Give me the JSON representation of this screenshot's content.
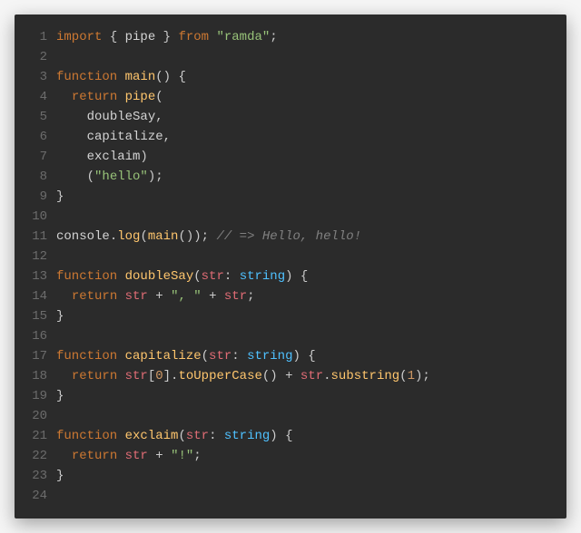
{
  "code": {
    "lines": [
      {
        "n": "1",
        "tokens": [
          {
            "c": "kw",
            "t": "import "
          },
          {
            "c": "punct",
            "t": "{ "
          },
          {
            "c": "ident",
            "t": "pipe"
          },
          {
            "c": "punct",
            "t": " } "
          },
          {
            "c": "kw",
            "t": "from "
          },
          {
            "c": "str",
            "t": "\"ramda\""
          },
          {
            "c": "punct",
            "t": ";"
          }
        ]
      },
      {
        "n": "2",
        "tokens": []
      },
      {
        "n": "3",
        "tokens": [
          {
            "c": "kw",
            "t": "function "
          },
          {
            "c": "fn",
            "t": "main"
          },
          {
            "c": "punct",
            "t": "() {"
          }
        ]
      },
      {
        "n": "4",
        "tokens": [
          {
            "c": "punct",
            "t": "  "
          },
          {
            "c": "kw",
            "t": "return "
          },
          {
            "c": "fn",
            "t": "pipe"
          },
          {
            "c": "punct",
            "t": "("
          }
        ]
      },
      {
        "n": "5",
        "tokens": [
          {
            "c": "punct",
            "t": "    "
          },
          {
            "c": "ident",
            "t": "doubleSay"
          },
          {
            "c": "punct",
            "t": ","
          }
        ]
      },
      {
        "n": "6",
        "tokens": [
          {
            "c": "punct",
            "t": "    "
          },
          {
            "c": "ident",
            "t": "capitalize"
          },
          {
            "c": "punct",
            "t": ","
          }
        ]
      },
      {
        "n": "7",
        "tokens": [
          {
            "c": "punct",
            "t": "    "
          },
          {
            "c": "ident",
            "t": "exclaim"
          },
          {
            "c": "punct",
            "t": ")"
          }
        ]
      },
      {
        "n": "8",
        "tokens": [
          {
            "c": "punct",
            "t": "    ("
          },
          {
            "c": "str",
            "t": "\"hello\""
          },
          {
            "c": "punct",
            "t": ");"
          }
        ]
      },
      {
        "n": "9",
        "tokens": [
          {
            "c": "punct",
            "t": "}"
          }
        ]
      },
      {
        "n": "10",
        "tokens": []
      },
      {
        "n": "11",
        "tokens": [
          {
            "c": "ident",
            "t": "console"
          },
          {
            "c": "punct",
            "t": "."
          },
          {
            "c": "fn",
            "t": "log"
          },
          {
            "c": "punct",
            "t": "("
          },
          {
            "c": "fn",
            "t": "main"
          },
          {
            "c": "punct",
            "t": "()); "
          },
          {
            "c": "comment",
            "t": "// => Hello, hello!"
          }
        ]
      },
      {
        "n": "12",
        "tokens": []
      },
      {
        "n": "13",
        "tokens": [
          {
            "c": "kw",
            "t": "function "
          },
          {
            "c": "fn",
            "t": "doubleSay"
          },
          {
            "c": "punct",
            "t": "("
          },
          {
            "c": "param",
            "t": "str"
          },
          {
            "c": "punct",
            "t": ": "
          },
          {
            "c": "type",
            "t": "string"
          },
          {
            "c": "punct",
            "t": ") {"
          }
        ]
      },
      {
        "n": "14",
        "tokens": [
          {
            "c": "punct",
            "t": "  "
          },
          {
            "c": "kw",
            "t": "return "
          },
          {
            "c": "param",
            "t": "str"
          },
          {
            "c": "punct",
            "t": " + "
          },
          {
            "c": "str",
            "t": "\", \""
          },
          {
            "c": "punct",
            "t": " + "
          },
          {
            "c": "param",
            "t": "str"
          },
          {
            "c": "punct",
            "t": ";"
          }
        ]
      },
      {
        "n": "15",
        "tokens": [
          {
            "c": "punct",
            "t": "}"
          }
        ]
      },
      {
        "n": "16",
        "tokens": []
      },
      {
        "n": "17",
        "tokens": [
          {
            "c": "kw",
            "t": "function "
          },
          {
            "c": "fn",
            "t": "capitalize"
          },
          {
            "c": "punct",
            "t": "("
          },
          {
            "c": "param",
            "t": "str"
          },
          {
            "c": "punct",
            "t": ": "
          },
          {
            "c": "type",
            "t": "string"
          },
          {
            "c": "punct",
            "t": ") {"
          }
        ]
      },
      {
        "n": "18",
        "tokens": [
          {
            "c": "punct",
            "t": "  "
          },
          {
            "c": "kw",
            "t": "return "
          },
          {
            "c": "param",
            "t": "str"
          },
          {
            "c": "punct",
            "t": "["
          },
          {
            "c": "num",
            "t": "0"
          },
          {
            "c": "punct",
            "t": "]."
          },
          {
            "c": "fn",
            "t": "toUpperCase"
          },
          {
            "c": "punct",
            "t": "() + "
          },
          {
            "c": "param",
            "t": "str"
          },
          {
            "c": "punct",
            "t": "."
          },
          {
            "c": "fn",
            "t": "substring"
          },
          {
            "c": "punct",
            "t": "("
          },
          {
            "c": "num",
            "t": "1"
          },
          {
            "c": "punct",
            "t": ");"
          }
        ]
      },
      {
        "n": "19",
        "tokens": [
          {
            "c": "punct",
            "t": "}"
          }
        ]
      },
      {
        "n": "20",
        "tokens": []
      },
      {
        "n": "21",
        "tokens": [
          {
            "c": "kw",
            "t": "function "
          },
          {
            "c": "fn",
            "t": "exclaim"
          },
          {
            "c": "punct",
            "t": "("
          },
          {
            "c": "param",
            "t": "str"
          },
          {
            "c": "punct",
            "t": ": "
          },
          {
            "c": "type",
            "t": "string"
          },
          {
            "c": "punct",
            "t": ") {"
          }
        ]
      },
      {
        "n": "22",
        "tokens": [
          {
            "c": "punct",
            "t": "  "
          },
          {
            "c": "kw",
            "t": "return "
          },
          {
            "c": "param",
            "t": "str"
          },
          {
            "c": "punct",
            "t": " + "
          },
          {
            "c": "str",
            "t": "\"!\""
          },
          {
            "c": "punct",
            "t": ";"
          }
        ]
      },
      {
        "n": "23",
        "tokens": [
          {
            "c": "punct",
            "t": "}"
          }
        ]
      },
      {
        "n": "24",
        "tokens": []
      }
    ]
  }
}
